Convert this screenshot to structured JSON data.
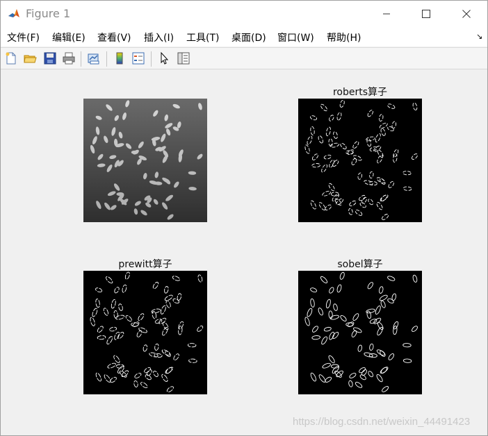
{
  "window": {
    "title": "Figure 1"
  },
  "menu": {
    "items": [
      "文件(F)",
      "编辑(E)",
      "查看(V)",
      "插入(I)",
      "工具(T)",
      "桌面(D)",
      "窗口(W)",
      "帮助(H)"
    ],
    "overflow_arrow": "↘"
  },
  "toolbar": {
    "buttons": [
      "new-figure-icon",
      "open-file-icon",
      "save-icon",
      "print-icon",
      "link-plot-icon",
      "colorbar-icon",
      "legend-icon",
      "pointer-icon",
      "property-editor-icon"
    ]
  },
  "figure": {
    "subplots": [
      {
        "title": "",
        "image": "rice-grayscale-image"
      },
      {
        "title": "roberts算子",
        "image": "roberts-edge-image"
      },
      {
        "title": "prewitt算子",
        "image": "prewitt-edge-image"
      },
      {
        "title": "sobel算子",
        "image": "sobel-edge-image"
      }
    ]
  },
  "watermark": "https://blog.csdn.net/weixin_44491423",
  "colors": {
    "window_bg": "#f0f0f0",
    "edge_bg": "#000000",
    "edge_line": "#ffffff",
    "rice_bg_dark": "#3a3a3a",
    "rice_grain": "#c8c8c8"
  }
}
